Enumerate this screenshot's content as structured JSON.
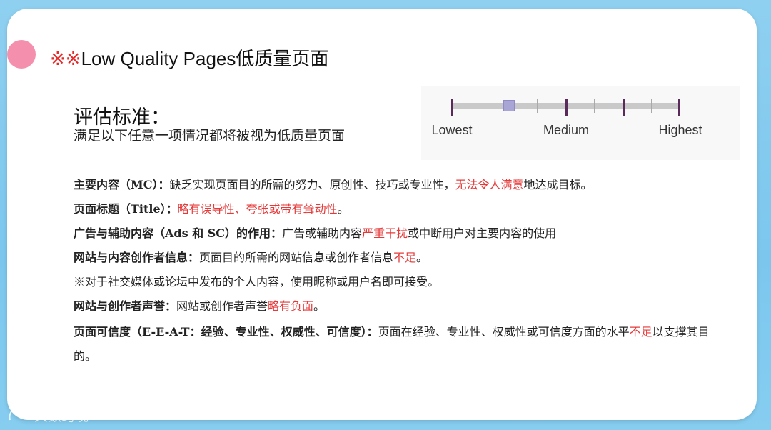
{
  "title": {
    "marks": "※※",
    "text": "Low Quality Pages低质量页面"
  },
  "criteria": {
    "heading": "评估标准：",
    "subtitle": "满足以下任意一项情况都将被视为低质量页面"
  },
  "scale": {
    "labels": [
      "Lowest",
      "Medium",
      "Highest"
    ],
    "marker_fraction": 0.25
  },
  "items": [
    {
      "label": "主要内容（MC）：",
      "before": "缺乏实现页面目的所需的努力、原创性、技巧或专业性，",
      "highlight": "无法令人满意",
      "after": "地达成目标。"
    },
    {
      "label": "页面标题（Title）：",
      "before": "",
      "highlight": "略有误导性、夸张或带有耸动性",
      "after": "。"
    },
    {
      "label": "广告与辅助内容（Ads 和 SC）的作用：",
      "before": "广告或辅助内容",
      "highlight": "严重干扰",
      "after": "或中断用户对主要内容的使用"
    },
    {
      "label": "网站与内容创作者信息：",
      "before": "页面目的所需的网站信息或创作者信息",
      "highlight": "不足",
      "after": "。"
    },
    {
      "label": "",
      "before": "※对于社交媒体或论坛中发布的个人内容，使用昵称或用户名即可接受。",
      "highlight": "",
      "after": ""
    },
    {
      "label": "网站与创作者声誉：",
      "before": "网站或创作者声誉",
      "highlight": "略有负面",
      "after": "。"
    },
    {
      "label": "页面可信度（E-E-A-T：经验、专业性、权威性、可信度）：",
      "before": "页面在经验、专业性、权威性或可信度方面的水平",
      "highlight": "不足",
      "after": "以支撑其目的。"
    }
  ],
  "watermark": "大数跨境",
  "colors": {
    "accent_red": "#e53a3a",
    "pink_dot": "#f490ad",
    "background_blue": "#86cdf0"
  }
}
